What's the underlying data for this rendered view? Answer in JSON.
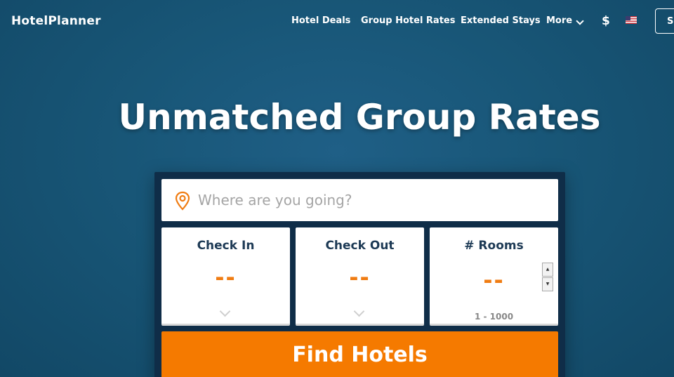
{
  "header": {
    "logo": "HotelPlanner",
    "nav": {
      "deals": "Hotel Deals",
      "group": "Group Hotel Rates",
      "extended": "Extended Stays",
      "more": "More"
    },
    "currency": "$",
    "signin": "Sign In"
  },
  "hero": {
    "title": "Unmatched Group Rates"
  },
  "search": {
    "destination_placeholder": "Where are you going?",
    "check_in": {
      "label": "Check In",
      "value": "--"
    },
    "check_out": {
      "label": "Check Out",
      "value": "--"
    },
    "rooms": {
      "label": "# Rooms",
      "value": "--",
      "range": "1 - 1000"
    },
    "submit": "Find Hotels"
  },
  "colors": {
    "accent": "#f57a00",
    "label": "#1d3a55",
    "panel": "#0f2d48"
  }
}
